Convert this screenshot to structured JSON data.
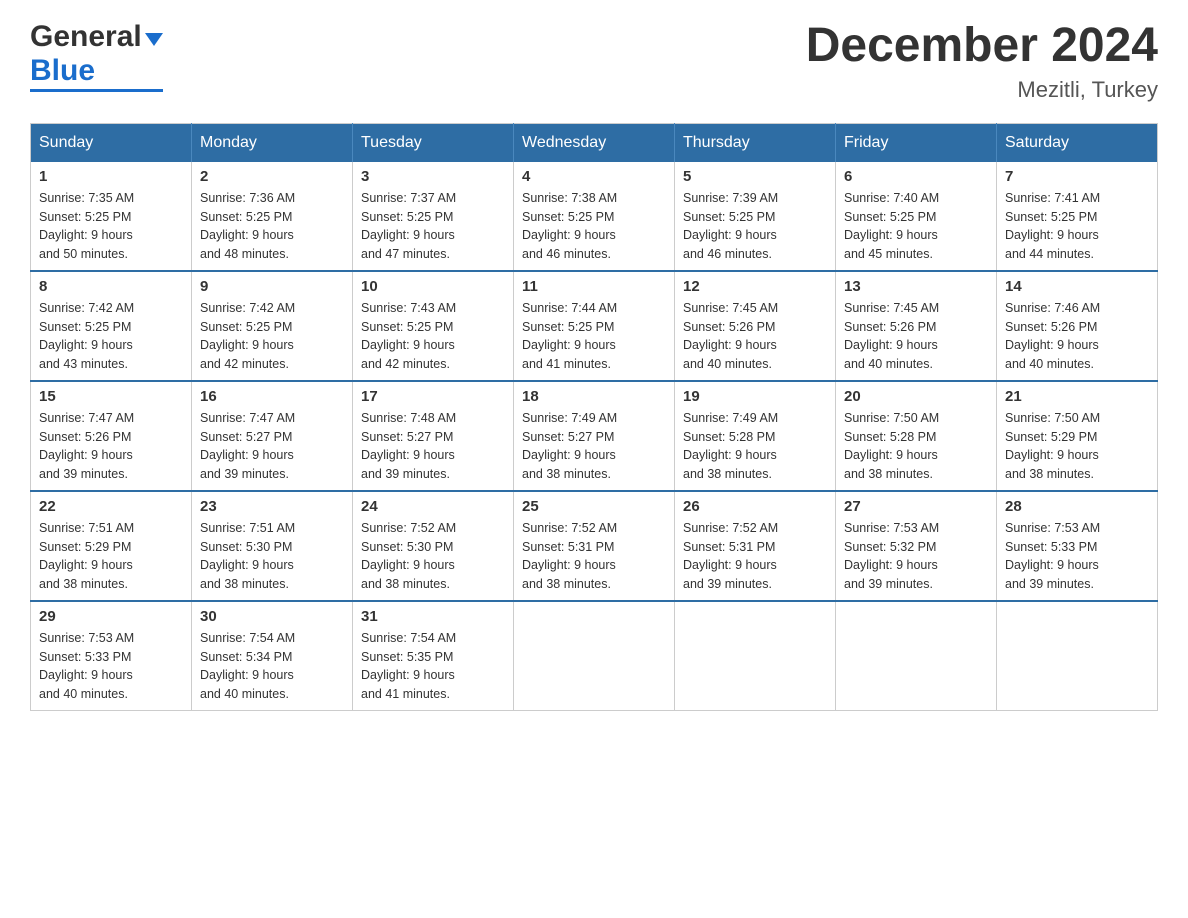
{
  "header": {
    "logo_general": "General",
    "logo_blue": "Blue",
    "month_title": "December 2024",
    "location": "Mezitli, Turkey"
  },
  "days_of_week": [
    "Sunday",
    "Monday",
    "Tuesday",
    "Wednesday",
    "Thursday",
    "Friday",
    "Saturday"
  ],
  "weeks": [
    [
      {
        "day": "1",
        "sunrise": "7:35 AM",
        "sunset": "5:25 PM",
        "daylight": "9 hours and 50 minutes."
      },
      {
        "day": "2",
        "sunrise": "7:36 AM",
        "sunset": "5:25 PM",
        "daylight": "9 hours and 48 minutes."
      },
      {
        "day": "3",
        "sunrise": "7:37 AM",
        "sunset": "5:25 PM",
        "daylight": "9 hours and 47 minutes."
      },
      {
        "day": "4",
        "sunrise": "7:38 AM",
        "sunset": "5:25 PM",
        "daylight": "9 hours and 46 minutes."
      },
      {
        "day": "5",
        "sunrise": "7:39 AM",
        "sunset": "5:25 PM",
        "daylight": "9 hours and 46 minutes."
      },
      {
        "day": "6",
        "sunrise": "7:40 AM",
        "sunset": "5:25 PM",
        "daylight": "9 hours and 45 minutes."
      },
      {
        "day": "7",
        "sunrise": "7:41 AM",
        "sunset": "5:25 PM",
        "daylight": "9 hours and 44 minutes."
      }
    ],
    [
      {
        "day": "8",
        "sunrise": "7:42 AM",
        "sunset": "5:25 PM",
        "daylight": "9 hours and 43 minutes."
      },
      {
        "day": "9",
        "sunrise": "7:42 AM",
        "sunset": "5:25 PM",
        "daylight": "9 hours and 42 minutes."
      },
      {
        "day": "10",
        "sunrise": "7:43 AM",
        "sunset": "5:25 PM",
        "daylight": "9 hours and 42 minutes."
      },
      {
        "day": "11",
        "sunrise": "7:44 AM",
        "sunset": "5:25 PM",
        "daylight": "9 hours and 41 minutes."
      },
      {
        "day": "12",
        "sunrise": "7:45 AM",
        "sunset": "5:26 PM",
        "daylight": "9 hours and 40 minutes."
      },
      {
        "day": "13",
        "sunrise": "7:45 AM",
        "sunset": "5:26 PM",
        "daylight": "9 hours and 40 minutes."
      },
      {
        "day": "14",
        "sunrise": "7:46 AM",
        "sunset": "5:26 PM",
        "daylight": "9 hours and 40 minutes."
      }
    ],
    [
      {
        "day": "15",
        "sunrise": "7:47 AM",
        "sunset": "5:26 PM",
        "daylight": "9 hours and 39 minutes."
      },
      {
        "day": "16",
        "sunrise": "7:47 AM",
        "sunset": "5:27 PM",
        "daylight": "9 hours and 39 minutes."
      },
      {
        "day": "17",
        "sunrise": "7:48 AM",
        "sunset": "5:27 PM",
        "daylight": "9 hours and 39 minutes."
      },
      {
        "day": "18",
        "sunrise": "7:49 AM",
        "sunset": "5:27 PM",
        "daylight": "9 hours and 38 minutes."
      },
      {
        "day": "19",
        "sunrise": "7:49 AM",
        "sunset": "5:28 PM",
        "daylight": "9 hours and 38 minutes."
      },
      {
        "day": "20",
        "sunrise": "7:50 AM",
        "sunset": "5:28 PM",
        "daylight": "9 hours and 38 minutes."
      },
      {
        "day": "21",
        "sunrise": "7:50 AM",
        "sunset": "5:29 PM",
        "daylight": "9 hours and 38 minutes."
      }
    ],
    [
      {
        "day": "22",
        "sunrise": "7:51 AM",
        "sunset": "5:29 PM",
        "daylight": "9 hours and 38 minutes."
      },
      {
        "day": "23",
        "sunrise": "7:51 AM",
        "sunset": "5:30 PM",
        "daylight": "9 hours and 38 minutes."
      },
      {
        "day": "24",
        "sunrise": "7:52 AM",
        "sunset": "5:30 PM",
        "daylight": "9 hours and 38 minutes."
      },
      {
        "day": "25",
        "sunrise": "7:52 AM",
        "sunset": "5:31 PM",
        "daylight": "9 hours and 38 minutes."
      },
      {
        "day": "26",
        "sunrise": "7:52 AM",
        "sunset": "5:31 PM",
        "daylight": "9 hours and 39 minutes."
      },
      {
        "day": "27",
        "sunrise": "7:53 AM",
        "sunset": "5:32 PM",
        "daylight": "9 hours and 39 minutes."
      },
      {
        "day": "28",
        "sunrise": "7:53 AM",
        "sunset": "5:33 PM",
        "daylight": "9 hours and 39 minutes."
      }
    ],
    [
      {
        "day": "29",
        "sunrise": "7:53 AM",
        "sunset": "5:33 PM",
        "daylight": "9 hours and 40 minutes."
      },
      {
        "day": "30",
        "sunrise": "7:54 AM",
        "sunset": "5:34 PM",
        "daylight": "9 hours and 40 minutes."
      },
      {
        "day": "31",
        "sunrise": "7:54 AM",
        "sunset": "5:35 PM",
        "daylight": "9 hours and 41 minutes."
      },
      null,
      null,
      null,
      null
    ]
  ],
  "labels": {
    "sunrise": "Sunrise:",
    "sunset": "Sunset:",
    "daylight": "Daylight:"
  }
}
